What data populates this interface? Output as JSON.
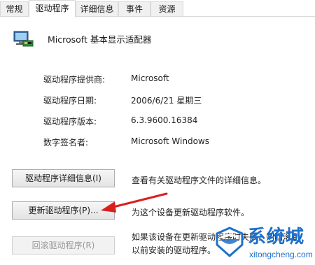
{
  "tabs": [
    {
      "label": "常规",
      "active": false
    },
    {
      "label": "驱动程序",
      "active": true
    },
    {
      "label": "详细信息",
      "active": false
    },
    {
      "label": "事件",
      "active": false
    },
    {
      "label": "资源",
      "active": false
    }
  ],
  "device": {
    "name": "Microsoft 基本显示适配器",
    "icon": "display-adapter-icon"
  },
  "properties": [
    {
      "label": "驱动程序提供商:",
      "value": "Microsoft"
    },
    {
      "label": "驱动程序日期:",
      "value": "2006/6/21 星期三"
    },
    {
      "label": "驱动程序版本:",
      "value": "6.3.9600.16384"
    },
    {
      "label": "数字签名者:",
      "value": "Microsoft Windows"
    }
  ],
  "actions": [
    {
      "label": "驱动程序详细信息(I)",
      "desc": "查看有关驱动程序文件的详细信息。",
      "enabled": true
    },
    {
      "label": "更新驱动程序(P)...",
      "desc": "为这个设备更新驱动程序软件。",
      "enabled": true
    },
    {
      "label": "回滚驱动程序(R)",
      "desc": "如果该设备在更新驱动程序时失败，则回滚到",
      "desc2": "以前安装的驱动程序。",
      "enabled": false
    }
  ],
  "annotation": {
    "color": "#d9201f",
    "icon": "red-arrow-icon"
  },
  "watermark": {
    "title": "系统城",
    "url": "xitongcheng.com",
    "color": "#1e6fc9"
  }
}
